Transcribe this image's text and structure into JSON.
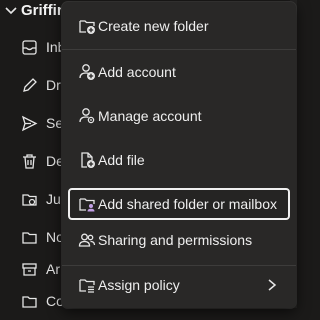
{
  "pane": {
    "account_title": "Griffin",
    "folders": [
      {
        "label": "Inb",
        "icon": "inbox-icon"
      },
      {
        "label": "Dra",
        "icon": "drafts-icon"
      },
      {
        "label": "Se",
        "icon": "sent-icon"
      },
      {
        "label": "De",
        "icon": "delete-icon"
      },
      {
        "label": "Jun",
        "icon": "junk-icon"
      },
      {
        "label": "No",
        "icon": "notes-icon"
      },
      {
        "label": "Ar",
        "icon": "archive-icon"
      },
      {
        "label": "Co",
        "icon": "folder-icon"
      }
    ]
  },
  "menu": {
    "items": [
      {
        "label": "Create new folder",
        "icon": "new-folder-icon"
      },
      {
        "label": "Add account",
        "icon": "add-account-icon"
      },
      {
        "label": "Manage account",
        "icon": "manage-account-icon"
      },
      {
        "label": "Add file",
        "icon": "add-file-icon"
      },
      {
        "label": "Add shared folder or mailbox",
        "icon": "shared-folder-icon",
        "focused": true
      },
      {
        "label": "Sharing and permissions",
        "icon": "people-icon"
      },
      {
        "label": "Assign policy",
        "icon": "policy-icon",
        "submenu": true
      }
    ]
  },
  "colors": {
    "background": "#1b1a19",
    "menu_background": "#292827",
    "focus_border": "#f0f0f0",
    "shared_folder_accent": "#c3a0e6"
  }
}
